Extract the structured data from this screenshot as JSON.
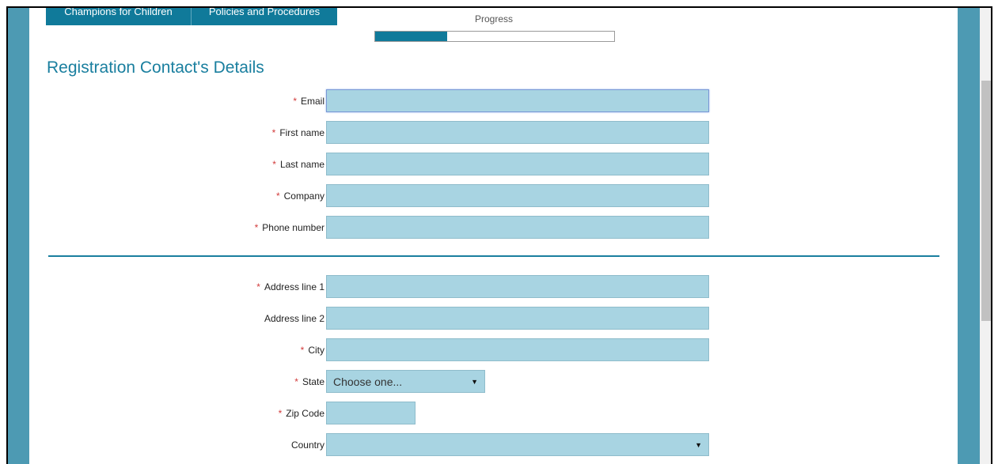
{
  "tabs": [
    {
      "label": "Champions for Children"
    },
    {
      "label": "Policies and Procedures"
    }
  ],
  "progress": {
    "label": "Progress",
    "percent": 30
  },
  "section_title": "Registration Contact's Details",
  "required_marker": "*",
  "contact_fields": {
    "email": {
      "label": "Email",
      "value": "",
      "required": true
    },
    "first_name": {
      "label": "First name",
      "value": "",
      "required": true
    },
    "last_name": {
      "label": "Last name",
      "value": "",
      "required": true
    },
    "company": {
      "label": "Company",
      "value": "",
      "required": true
    },
    "phone": {
      "label": "Phone number",
      "value": "",
      "required": true
    }
  },
  "address_fields": {
    "address1": {
      "label": "Address line 1",
      "value": "",
      "required": true
    },
    "address2": {
      "label": "Address line 2",
      "value": "",
      "required": false
    },
    "city": {
      "label": "City",
      "value": "",
      "required": true
    },
    "state": {
      "label": "State",
      "selected": "Choose one...",
      "required": true
    },
    "zip": {
      "label": "Zip Code",
      "value": "",
      "required": true
    },
    "country": {
      "label": "Country",
      "selected": "",
      "required": false
    }
  },
  "colors": {
    "accent": "#107a9a",
    "field_bg": "#a8d4e2",
    "side_panel": "#4d9ab3",
    "required": "#d23b3b"
  }
}
